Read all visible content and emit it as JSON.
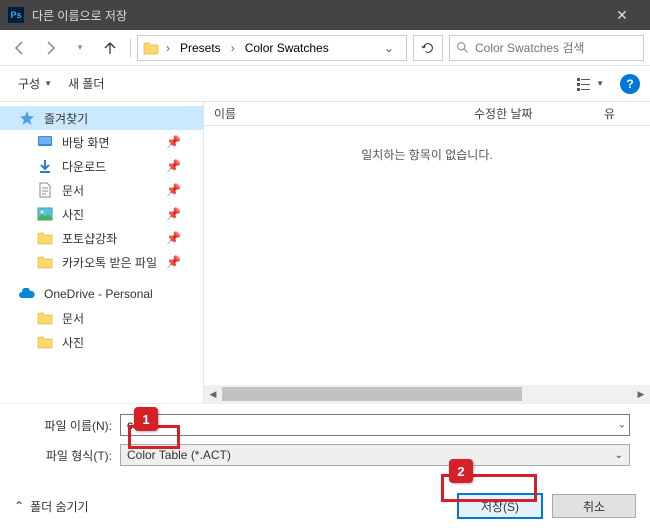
{
  "title": "다른 이름으로 저장",
  "ps_badge": "Ps",
  "nav": {
    "crumb1": "Presets",
    "crumb2": "Color Swatches"
  },
  "search": {
    "placeholder": "Color Swatches 검색"
  },
  "toolbar": {
    "organize": "구성",
    "new_folder": "새 폴더"
  },
  "sidebar": {
    "quick_access": "즐겨찾기",
    "items": [
      {
        "label": "바탕 화면"
      },
      {
        "label": "다운로드"
      },
      {
        "label": "문서"
      },
      {
        "label": "사진"
      },
      {
        "label": "포토샵강좌"
      },
      {
        "label": "카카오톡 받은 파일"
      }
    ],
    "onedrive": "OneDrive - Personal",
    "od_items": [
      {
        "label": "문서"
      },
      {
        "label": "사진"
      }
    ]
  },
  "columns": {
    "name": "이름",
    "date": "수정한 날짜",
    "type": "유"
  },
  "empty_msg": "일치하는 항목이 없습니다.",
  "filename": {
    "label": "파일 이름(N):",
    "value": "colors"
  },
  "filetype": {
    "label": "파일 형식(T):",
    "value": "Color Table (*.ACT)"
  },
  "footer": {
    "hide": "폴더 숨기기",
    "save": "저장(S)",
    "cancel": "취소"
  },
  "markers": {
    "m1": "1",
    "m2": "2"
  }
}
